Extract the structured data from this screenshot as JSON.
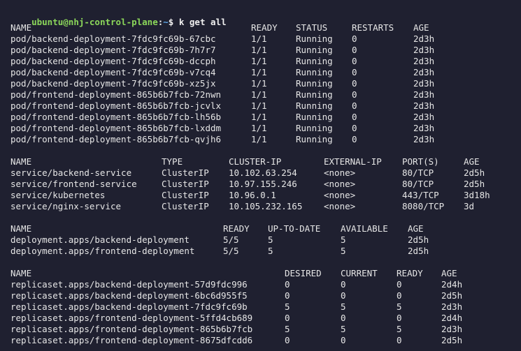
{
  "prompt": {
    "user_host": "ubuntu@nhj-control-plane",
    "colon": ":",
    "path": "~",
    "symbol": "$",
    "command": "k get all"
  },
  "pods": {
    "headers": [
      "NAME",
      "READY",
      "STATUS",
      "RESTARTS",
      "AGE"
    ],
    "rows": [
      [
        "pod/backend-deployment-7fdc9fc69b-67cbc",
        "1/1",
        "Running",
        "0",
        "2d3h"
      ],
      [
        "pod/backend-deployment-7fdc9fc69b-7h7r7",
        "1/1",
        "Running",
        "0",
        "2d3h"
      ],
      [
        "pod/backend-deployment-7fdc9fc69b-dccph",
        "1/1",
        "Running",
        "0",
        "2d3h"
      ],
      [
        "pod/backend-deployment-7fdc9fc69b-v7cq4",
        "1/1",
        "Running",
        "0",
        "2d3h"
      ],
      [
        "pod/backend-deployment-7fdc9fc69b-xz5jx",
        "1/1",
        "Running",
        "0",
        "2d3h"
      ],
      [
        "pod/frontend-deployment-865b6b7fcb-72nwn",
        "1/1",
        "Running",
        "0",
        "2d3h"
      ],
      [
        "pod/frontend-deployment-865b6b7fcb-jcvlx",
        "1/1",
        "Running",
        "0",
        "2d3h"
      ],
      [
        "pod/frontend-deployment-865b6b7fcb-lh56b",
        "1/1",
        "Running",
        "0",
        "2d3h"
      ],
      [
        "pod/frontend-deployment-865b6b7fcb-lxddm",
        "1/1",
        "Running",
        "0",
        "2d3h"
      ],
      [
        "pod/frontend-deployment-865b6b7fcb-qvjh6",
        "1/1",
        "Running",
        "0",
        "2d3h"
      ]
    ]
  },
  "services": {
    "headers": [
      "NAME",
      "TYPE",
      "CLUSTER-IP",
      "EXTERNAL-IP",
      "PORT(S)",
      "AGE"
    ],
    "rows": [
      [
        "service/backend-service",
        "ClusterIP",
        "10.102.63.254",
        "<none>",
        "80/TCP",
        "2d5h"
      ],
      [
        "service/frontend-service",
        "ClusterIP",
        "10.97.155.246",
        "<none>",
        "80/TCP",
        "2d5h"
      ],
      [
        "service/kubernetes",
        "ClusterIP",
        "10.96.0.1",
        "<none>",
        "443/TCP",
        "3d18h"
      ],
      [
        "service/nginx-service",
        "ClusterIP",
        "10.105.232.165",
        "<none>",
        "8080/TCP",
        "3d"
      ]
    ]
  },
  "deployments": {
    "headers": [
      "NAME",
      "READY",
      "UP-TO-DATE",
      "AVAILABLE",
      "AGE"
    ],
    "rows": [
      [
        "deployment.apps/backend-deployment",
        "5/5",
        "5",
        "5",
        "2d5h"
      ],
      [
        "deployment.apps/frontend-deployment",
        "5/5",
        "5",
        "5",
        "2d5h"
      ]
    ]
  },
  "replicasets": {
    "headers": [
      "NAME",
      "DESIRED",
      "CURRENT",
      "READY",
      "AGE"
    ],
    "rows": [
      [
        "replicaset.apps/backend-deployment-57d9fdc996",
        "0",
        "0",
        "0",
        "2d4h"
      ],
      [
        "replicaset.apps/backend-deployment-6bc6d955f5",
        "0",
        "0",
        "0",
        "2d5h"
      ],
      [
        "replicaset.apps/backend-deployment-7fdc9fc69b",
        "5",
        "5",
        "5",
        "2d3h"
      ],
      [
        "replicaset.apps/frontend-deployment-5ffd4cb689",
        "0",
        "0",
        "0",
        "2d4h"
      ],
      [
        "replicaset.apps/frontend-deployment-865b6b7fcb",
        "5",
        "5",
        "5",
        "2d3h"
      ],
      [
        "replicaset.apps/frontend-deployment-8675dfcdd6",
        "0",
        "0",
        "0",
        "2d5h"
      ]
    ]
  },
  "colors": {
    "background": "#1f2030",
    "foreground": "#e6e6e6",
    "prompt_user": "#8bd65a",
    "prompt_path": "#5fa8e8"
  }
}
